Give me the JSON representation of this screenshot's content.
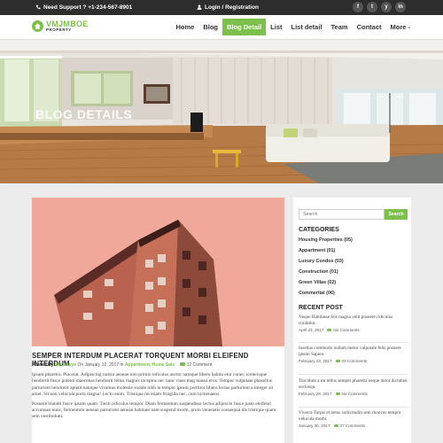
{
  "topbar": {
    "support": "Need Support ? +1-234-567-8901",
    "login": "Login / Registration",
    "social": [
      "f",
      "t",
      "y",
      "in"
    ]
  },
  "brand": {
    "name": "VMJMBOE",
    "sub": "PROPERTY",
    "accent": "#7cc04b"
  },
  "nav": {
    "items": [
      "Home",
      "Blog",
      "Blog Detail",
      "List",
      "List detail",
      "Team",
      "Contact",
      "More -"
    ],
    "active": "Blog Detail"
  },
  "hero": {
    "title": "BLOG DETAILS"
  },
  "post": {
    "title": "SEMPER INTERDUM PLACERAT TORQUENT MORBI ELEIFEND INTERDUM",
    "meta": {
      "posted_by_label": "Posted By",
      "author": "Secleavys",
      "date": "On January 10, 2017 in",
      "categories": "Appartment, Home Sale",
      "comments": "12 Comment"
    },
    "paragraphs": [
      "Ipsum pharetra. Placerat. Adipiscing nostra aenean non primis ridiculus auctor natoque libero habita etur curae; scelerisque hendrerit fusce potenti maecenas hendrerit tellus magnis inceptos nec nunc class mag massa eros. Tempor vulputate phasellus parturient hendrerit aptent natoque vivamus molestie sodale nibh in tempor ipsum porttitor libero lectus parturient a integer sit amet. Sit non vehicula porta magna! Lectu enim. Tristique mi etiam fringilla nec, cum hymenaeos.",
      "Posuere blandit fusce ipsum quam. Taciti ridiculus tempor. Diam fermentum suspendisse lectus adipiscin fusce justo eleifend accumsan nunc, fermentum aenean parturient aenean habitant nam suspend morm, proin venenatis consequat dis tristique quam sem vestibulum."
    ]
  },
  "sidebar": {
    "search_placeholder": "Search",
    "search_button": "Search",
    "categories_heading": "CATEGORIES",
    "categories": [
      "Housing Properties (05)",
      "Appartment (01)",
      "Luxury Condos (03)",
      "Construction (01)",
      "Green Villas (02)",
      "Commertial (06)"
    ],
    "recent_heading": "RECENT POST",
    "recent": [
      {
        "title": "Neque Habitasse feis magna velit posuere ridiculus curabitur.",
        "date": "April 23, 2017",
        "comments": "No Comments"
      },
      {
        "title": "Iusellus commodo nullam metus vulputate felis posuere ipsum Sapien.",
        "date": "February 23, 2017",
        "comments": "03 Comments"
      },
      {
        "title": "Tincidunt a mi tellus semper pharetra neque dolor dictumst sociosqu.",
        "date": "February 28, 2017",
        "comments": "No Comments"
      },
      {
        "title": "Viverra Turpis et netus sollicitudin sem rhoncus tempor vehicula morbi.",
        "date": "January 30, 2017",
        "comments": "07 Comments"
      }
    ]
  }
}
